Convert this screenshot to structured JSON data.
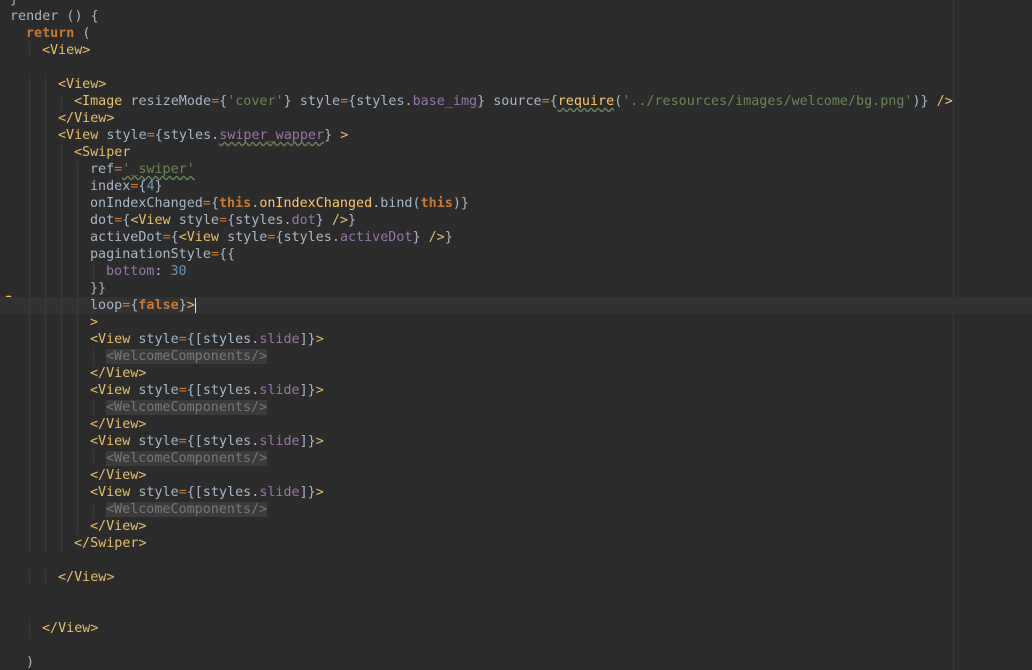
{
  "editor": {
    "colors": {
      "background": "#2b2b2b",
      "keyword": "#cc7832",
      "tag": "#e8bf6a",
      "string": "#6a8759",
      "number": "#6897bb",
      "property": "#9876aa",
      "function": "#ffc66d",
      "text": "#a9b7c6"
    },
    "gutter_icon": "lightbulb-icon",
    "lines": [
      {
        "indent": 0,
        "tokens": [
          [
            "punc",
            "}"
          ]
        ]
      },
      {
        "indent": 0,
        "tokens": [
          [
            "attr",
            "render () {"
          ]
        ]
      },
      {
        "indent": 1,
        "tokens": [
          [
            "kw",
            "return"
          ],
          [
            "punc",
            " ("
          ]
        ]
      },
      {
        "indent": 2,
        "tokens": [
          [
            "tag",
            "<View>"
          ]
        ]
      },
      {
        "indent": 0,
        "tokens": []
      },
      {
        "indent": 3,
        "tokens": [
          [
            "tag",
            "<View>"
          ]
        ]
      },
      {
        "indent": 4,
        "tokens": [
          [
            "tag",
            "<Image "
          ],
          [
            "attr",
            "resizeMode"
          ],
          [
            "eq",
            "="
          ],
          [
            "punc",
            "{"
          ],
          [
            "str",
            "'cover'"
          ],
          [
            "punc",
            "} "
          ],
          [
            "attr",
            "style"
          ],
          [
            "eq",
            "="
          ],
          [
            "punc",
            "{styles."
          ],
          [
            "prop",
            "base_img"
          ],
          [
            "punc",
            "} "
          ],
          [
            "attr",
            "source"
          ],
          [
            "eq",
            "="
          ],
          [
            "punc",
            "{"
          ],
          [
            "fn-typo",
            "require"
          ],
          [
            "punc",
            "("
          ],
          [
            "str",
            "'../resources/images/welcome/bg.png'"
          ],
          [
            "punc",
            ")} "
          ],
          [
            "tag",
            "/>"
          ]
        ]
      },
      {
        "indent": 3,
        "tokens": [
          [
            "tag",
            "</View>"
          ]
        ]
      },
      {
        "indent": 3,
        "tokens": [
          [
            "tag",
            "<View "
          ],
          [
            "attr",
            "style"
          ],
          [
            "eq",
            "="
          ],
          [
            "punc",
            "{styles."
          ],
          [
            "prop-typo",
            "swiper_wapper"
          ],
          [
            "punc",
            "} "
          ],
          [
            "tag",
            ">"
          ]
        ]
      },
      {
        "indent": 4,
        "tokens": [
          [
            "tag",
            "<Swiper"
          ]
        ]
      },
      {
        "indent": 5,
        "tokens": [
          [
            "attr",
            "ref"
          ],
          [
            "eq",
            "="
          ],
          [
            "str-typo",
            "'_swiper'"
          ]
        ]
      },
      {
        "indent": 5,
        "tokens": [
          [
            "attr",
            "index"
          ],
          [
            "eq",
            "="
          ],
          [
            "punc",
            "{"
          ],
          [
            "num",
            "4"
          ],
          [
            "punc",
            "}"
          ]
        ]
      },
      {
        "indent": 5,
        "tokens": [
          [
            "attr",
            "onIndexChanged"
          ],
          [
            "eq",
            "="
          ],
          [
            "punc",
            "{"
          ],
          [
            "kw",
            "this"
          ],
          [
            "punc",
            "."
          ],
          [
            "fn",
            "onIndexChanged"
          ],
          [
            "punc",
            ".bind("
          ],
          [
            "kw",
            "this"
          ],
          [
            "punc",
            ")}"
          ]
        ]
      },
      {
        "indent": 5,
        "tokens": [
          [
            "attr",
            "dot"
          ],
          [
            "eq",
            "="
          ],
          [
            "punc",
            "{"
          ],
          [
            "tag",
            "<View "
          ],
          [
            "attr",
            "style"
          ],
          [
            "eq",
            "="
          ],
          [
            "punc",
            "{styles."
          ],
          [
            "prop",
            "dot"
          ],
          [
            "punc",
            "} "
          ],
          [
            "tag",
            "/>"
          ],
          [
            "punc",
            "}"
          ]
        ]
      },
      {
        "indent": 5,
        "tokens": [
          [
            "attr",
            "activeDot"
          ],
          [
            "eq",
            "="
          ],
          [
            "punc",
            "{"
          ],
          [
            "tag",
            "<View "
          ],
          [
            "attr",
            "style"
          ],
          [
            "eq",
            "="
          ],
          [
            "punc",
            "{styles."
          ],
          [
            "prop",
            "activeDot"
          ],
          [
            "punc",
            "} "
          ],
          [
            "tag",
            "/>"
          ],
          [
            "punc",
            "}"
          ]
        ]
      },
      {
        "indent": 5,
        "tokens": [
          [
            "attr",
            "paginationStyle"
          ],
          [
            "eq",
            "="
          ],
          [
            "punc",
            "{{"
          ]
        ]
      },
      {
        "indent": 6,
        "tokens": [
          [
            "prop",
            "bottom"
          ],
          [
            "punc",
            ": "
          ],
          [
            "num",
            "30"
          ]
        ]
      },
      {
        "indent": 5,
        "tokens": [
          [
            "punc",
            "}}"
          ]
        ]
      },
      {
        "indent": 5,
        "current": true,
        "tokens": [
          [
            "attr",
            "loop"
          ],
          [
            "eq",
            "="
          ],
          [
            "punc",
            "{"
          ],
          [
            "kw",
            "false"
          ],
          [
            "punc",
            "}"
          ],
          [
            "tag",
            ">"
          ],
          [
            "caret",
            ""
          ]
        ]
      },
      {
        "indent": 5,
        "tokens": [
          [
            "tag",
            ">"
          ]
        ]
      },
      {
        "indent": 5,
        "tokens": [
          [
            "tag",
            "<View "
          ],
          [
            "attr",
            "style"
          ],
          [
            "eq",
            "="
          ],
          [
            "punc",
            "{[styles."
          ],
          [
            "prop",
            "slide"
          ],
          [
            "punc",
            "]}"
          ],
          [
            "tag",
            ">"
          ]
        ]
      },
      {
        "indent": 6,
        "tokens": [
          [
            "unused",
            "<WelcomeComponents/>"
          ]
        ]
      },
      {
        "indent": 5,
        "tokens": [
          [
            "tag",
            "</View>"
          ]
        ]
      },
      {
        "indent": 5,
        "tokens": [
          [
            "tag",
            "<View "
          ],
          [
            "attr",
            "style"
          ],
          [
            "eq",
            "="
          ],
          [
            "punc",
            "{[styles."
          ],
          [
            "prop",
            "slide"
          ],
          [
            "punc",
            "]}"
          ],
          [
            "tag",
            ">"
          ]
        ]
      },
      {
        "indent": 6,
        "tokens": [
          [
            "unused",
            "<WelcomeComponents/>"
          ]
        ]
      },
      {
        "indent": 5,
        "tokens": [
          [
            "tag",
            "</View>"
          ]
        ]
      },
      {
        "indent": 5,
        "tokens": [
          [
            "tag",
            "<View "
          ],
          [
            "attr",
            "style"
          ],
          [
            "eq",
            "="
          ],
          [
            "punc",
            "{[styles."
          ],
          [
            "prop",
            "slide"
          ],
          [
            "punc",
            "]}"
          ],
          [
            "tag",
            ">"
          ]
        ]
      },
      {
        "indent": 6,
        "tokens": [
          [
            "unused",
            "<WelcomeComponents/>"
          ]
        ]
      },
      {
        "indent": 5,
        "tokens": [
          [
            "tag",
            "</View>"
          ]
        ]
      },
      {
        "indent": 5,
        "tokens": [
          [
            "tag",
            "<View "
          ],
          [
            "attr",
            "style"
          ],
          [
            "eq",
            "="
          ],
          [
            "punc",
            "{[styles."
          ],
          [
            "prop",
            "slide"
          ],
          [
            "punc",
            "]}"
          ],
          [
            "tag",
            ">"
          ]
        ]
      },
      {
        "indent": 6,
        "tokens": [
          [
            "unused",
            "<WelcomeComponents/>"
          ]
        ]
      },
      {
        "indent": 5,
        "tokens": [
          [
            "tag",
            "</View>"
          ]
        ]
      },
      {
        "indent": 4,
        "tokens": [
          [
            "tag",
            "</Swiper>"
          ]
        ]
      },
      {
        "indent": 0,
        "tokens": []
      },
      {
        "indent": 3,
        "tokens": [
          [
            "tag",
            "</View>"
          ]
        ]
      },
      {
        "indent": 0,
        "tokens": []
      },
      {
        "indent": 0,
        "tokens": []
      },
      {
        "indent": 2,
        "tokens": [
          [
            "tag",
            "</View>"
          ]
        ]
      },
      {
        "indent": 0,
        "tokens": []
      },
      {
        "indent": 1,
        "tokens": [
          [
            "punc",
            ")"
          ]
        ]
      }
    ]
  }
}
